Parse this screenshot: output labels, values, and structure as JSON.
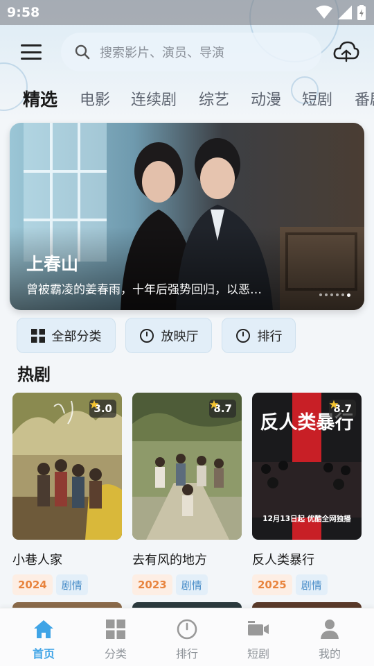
{
  "status_bar": {
    "time": "9:58"
  },
  "search": {
    "placeholder": "搜索影片、演员、导演"
  },
  "tabs": [
    "精选",
    "电影",
    "连续剧",
    "综艺",
    "动漫",
    "短剧",
    "番剧"
  ],
  "active_tab": "精选",
  "banner": {
    "title": "上春山",
    "description": "曾被霸凌的姜春雨，十年后强势回归，以恶…",
    "slide_count": 6,
    "active_slide": 6
  },
  "quick_links": [
    "全部分类",
    "放映厅",
    "排行"
  ],
  "section": {
    "title": "热剧"
  },
  "dramas": [
    {
      "title": "小巷人家",
      "rating": "3.0",
      "year": "2024",
      "genre": "剧情"
    },
    {
      "title": "去有风的地方",
      "rating": "8.7",
      "year": "2023",
      "genre": "剧情"
    },
    {
      "title": "反人类暴行",
      "rating": "8.7",
      "year": "2025",
      "genre": "剧情",
      "poster_text": "反人类暴行",
      "poster_caption": "12月13日起 优酷全网独播"
    }
  ],
  "bottom_nav": [
    "首页",
    "分类",
    "排行",
    "短剧",
    "我的"
  ],
  "active_nav": "首页",
  "colors": {
    "accent": "#3fa4e6",
    "year_tag": "#e8843e",
    "genre_tag": "#4c8fc9",
    "rating_star": "#f2c230"
  }
}
